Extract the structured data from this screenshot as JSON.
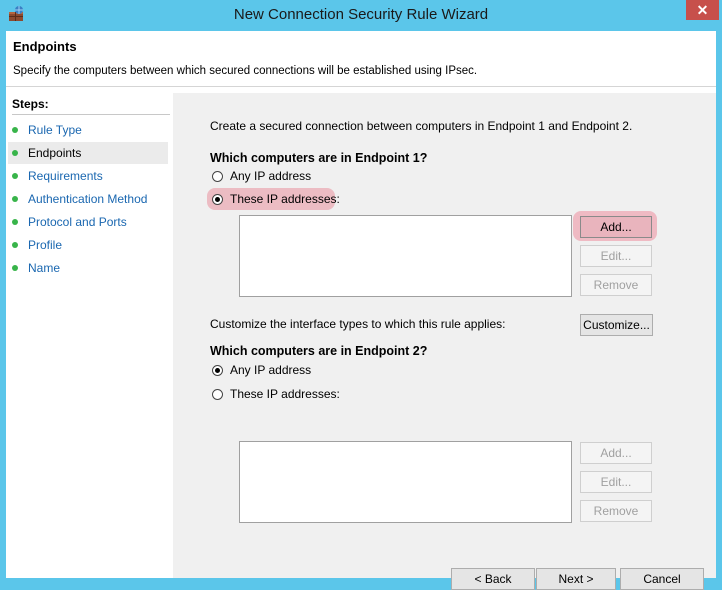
{
  "window": {
    "title": "New Connection Security Rule Wizard",
    "close_glyph": "✕"
  },
  "header": {
    "title": "Endpoints",
    "description": "Specify the computers between which secured connections will be established using IPsec."
  },
  "steps": {
    "title": "Steps:",
    "items": [
      {
        "label": "Rule Type"
      },
      {
        "label": "Endpoints"
      },
      {
        "label": "Requirements"
      },
      {
        "label": "Authentication Method"
      },
      {
        "label": "Protocol and Ports"
      },
      {
        "label": "Profile"
      },
      {
        "label": "Name"
      }
    ],
    "active_index": 1
  },
  "main": {
    "intro": "Create a secured connection between computers in Endpoint 1 and Endpoint 2.",
    "endpoint1": {
      "heading": "Which computers are in Endpoint 1?",
      "option_any": "Any IP address",
      "option_these": "These IP addresses:",
      "selected": "these",
      "add": "Add...",
      "edit": "Edit...",
      "remove": "Remove"
    },
    "customize_text": "Customize the interface types to which this rule applies:",
    "customize_button": "Customize...",
    "endpoint2": {
      "heading": "Which computers are in Endpoint 2?",
      "option_any": "Any IP address",
      "option_these": "These IP addresses:",
      "selected": "any",
      "add": "Add...",
      "edit": "Edit...",
      "remove": "Remove"
    }
  },
  "footer": {
    "back": "< Back",
    "next": "Next >",
    "cancel": "Cancel"
  },
  "colors": {
    "frame": "#5bc6ea",
    "close": "#c7504b",
    "highlight": "#ecbcc3",
    "step_dot": "#38b44a",
    "step_link": "#1a67b0"
  }
}
